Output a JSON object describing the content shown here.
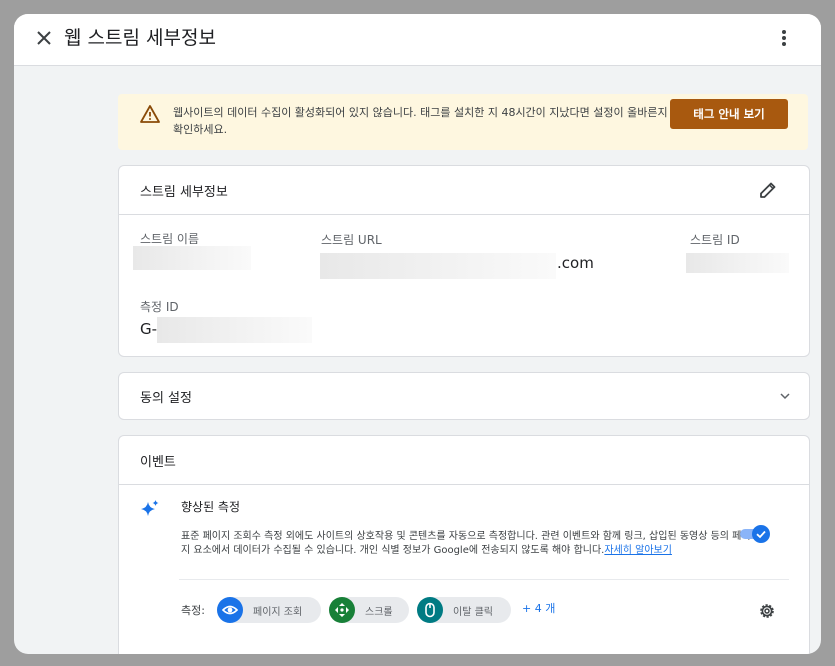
{
  "header": {
    "title": "웹 스트림 세부정보"
  },
  "banner": {
    "text": "웹사이트의 데이터 수집이 활성화되어 있지 않습니다. 태그를 설치한 지 48시간이 지났다면 설정이 올바른지 확인하세요.",
    "button_label": "태그 안내 보기"
  },
  "stream_details": {
    "title": "스트림 세부정보",
    "name_label": "스트림 이름",
    "url_label": "스트림 URL",
    "url_suffix": ".com",
    "id_label": "스트림 ID",
    "measurement_label": "측정 ID",
    "measurement_prefix": "G-"
  },
  "consent": {
    "title": "동의 설정"
  },
  "events": {
    "title": "이벤트",
    "enhanced_title": "향상된 측정",
    "description": "표준 페이지 조회수 측정 외에도 사이트의 상호작용 및 콘텐츠를 자동으로 측정합니다. 관련 이벤트와 함께 링크, 삽입된 동영상 등의 페이지 요소에서 데이터가 수집될 수 있습니다. 개인 식별 정보가 Google에 전송되지 않도록 해야 합니다.",
    "learn_more": "자세히 알아보기",
    "measure_label": "측정:",
    "chips": [
      {
        "label": "페이지 조회",
        "color": "#1a73e8",
        "icon": "eye-icon"
      },
      {
        "label": "스크롤",
        "color": "#188038",
        "icon": "crosshair-icon"
      },
      {
        "label": "이탈 클릭",
        "color": "#007b83",
        "icon": "mouse-icon"
      }
    ],
    "more_label": "+ 4 개",
    "toggle_on": true
  }
}
